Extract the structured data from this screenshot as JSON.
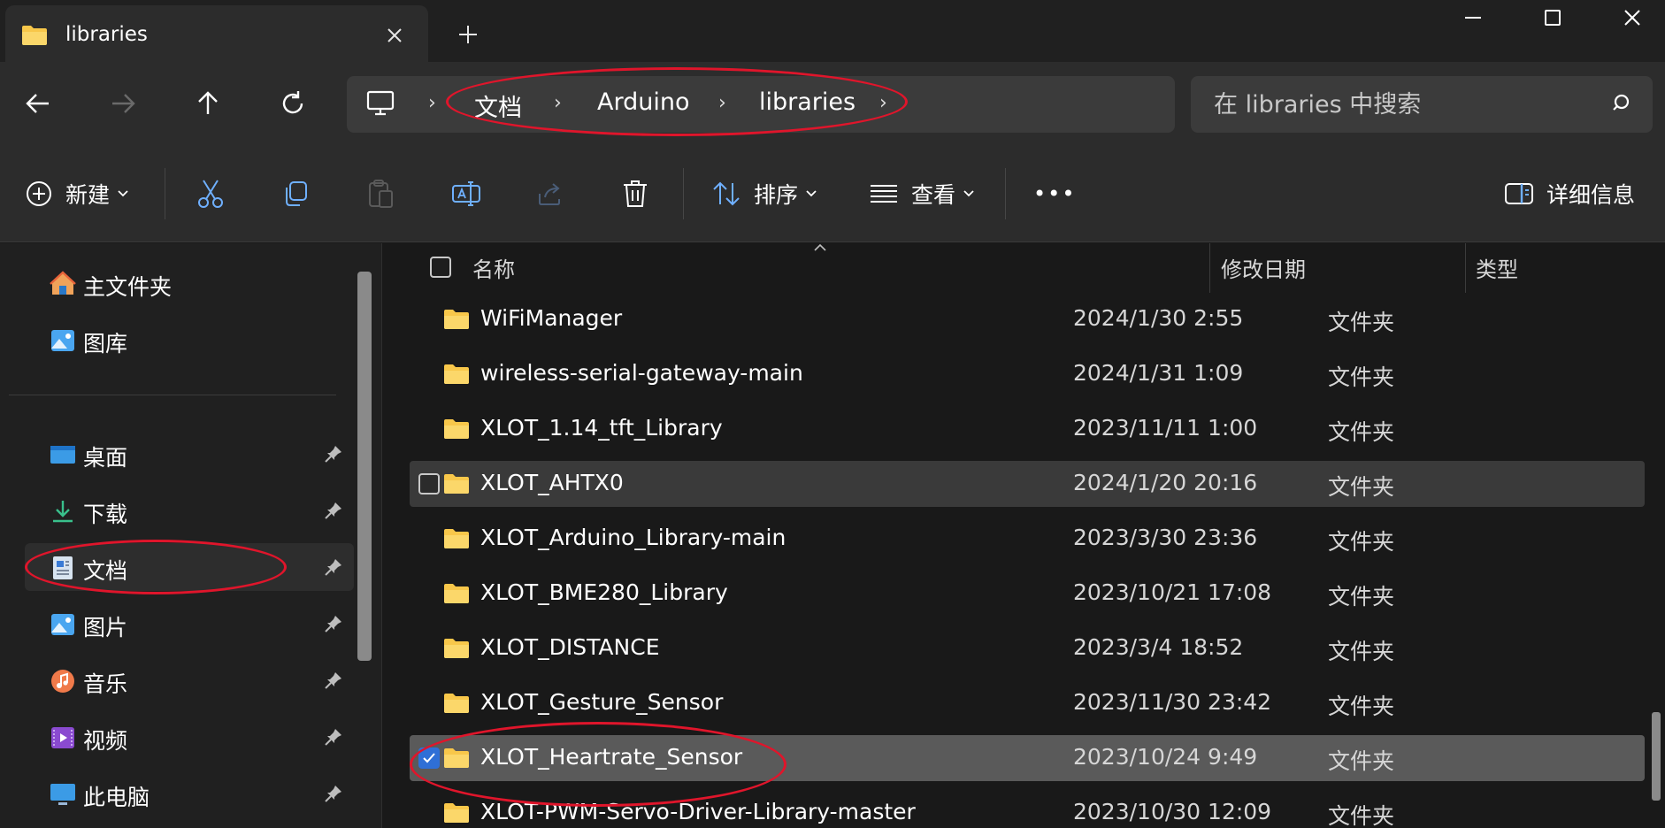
{
  "tab": {
    "title": "libraries",
    "new_tab": "+"
  },
  "address": {
    "crumbs": [
      "文档",
      "Arduino",
      "libraries"
    ]
  },
  "search": {
    "placeholder": "在 libraries 中搜索"
  },
  "commands": {
    "new": "新建",
    "sort": "排序",
    "view": "查看",
    "more": "•••",
    "details": "详细信息"
  },
  "sidebar": {
    "items": [
      {
        "label": "主文件夹",
        "icon": "home-icon"
      },
      {
        "label": "图库",
        "icon": "gallery-icon"
      },
      {
        "label": "桌面",
        "icon": "desktop-icon",
        "pinned": true
      },
      {
        "label": "下载",
        "icon": "download-icon",
        "pinned": true
      },
      {
        "label": "文档",
        "icon": "documents-icon",
        "pinned": true,
        "selected": true
      },
      {
        "label": "图片",
        "icon": "pictures-icon",
        "pinned": true
      },
      {
        "label": "音乐",
        "icon": "music-icon",
        "pinned": true
      },
      {
        "label": "视频",
        "icon": "videos-icon",
        "pinned": true
      },
      {
        "label": "此电脑",
        "icon": "this-pc-icon",
        "pinned": true
      }
    ]
  },
  "columns": {
    "name": "名称",
    "modified": "修改日期",
    "type": "类型"
  },
  "files": [
    {
      "name": "WiFiManager",
      "date": "2024/1/30 2:55",
      "type": "文件夹",
      "state": "normal"
    },
    {
      "name": "wireless-serial-gateway-main",
      "date": "2024/1/31 1:09",
      "type": "文件夹",
      "state": "normal"
    },
    {
      "name": "XLOT_1.14_tft_Library",
      "date": "2023/11/11 1:00",
      "type": "文件夹",
      "state": "normal"
    },
    {
      "name": "XLOT_AHTX0",
      "date": "2024/1/20 20:16",
      "type": "文件夹",
      "state": "hover"
    },
    {
      "name": "XLOT_Arduino_Library-main",
      "date": "2023/3/30 23:36",
      "type": "文件夹",
      "state": "normal"
    },
    {
      "name": "XLOT_BME280_Library",
      "date": "2023/10/21 17:08",
      "type": "文件夹",
      "state": "normal"
    },
    {
      "name": "XLOT_DISTANCE",
      "date": "2023/3/4 18:52",
      "type": "文件夹",
      "state": "normal"
    },
    {
      "name": "XLOT_Gesture_Sensor",
      "date": "2023/11/30 23:42",
      "type": "文件夹",
      "state": "normal"
    },
    {
      "name": "XLOT_Heartrate_Sensor",
      "date": "2023/10/24 9:49",
      "type": "文件夹",
      "state": "selected"
    },
    {
      "name": "XLOT-PWM-Servo-Driver-Library-master",
      "date": "2023/10/30 12:09",
      "type": "文件夹",
      "state": "normal"
    }
  ],
  "colors": {
    "accent": "#2f6fd6",
    "annotation": "#e0152b",
    "folder": "#f8c74a"
  }
}
